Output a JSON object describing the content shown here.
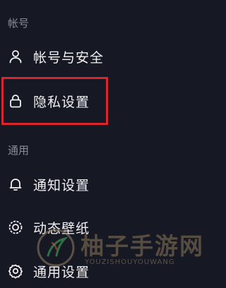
{
  "sections": [
    {
      "header": "帐号",
      "items": [
        {
          "label": "帐号与安全",
          "icon": "person-icon"
        },
        {
          "label": "隐私设置",
          "icon": "lock-icon"
        }
      ]
    },
    {
      "header": "通用",
      "items": [
        {
          "label": "通知设置",
          "icon": "bell-icon"
        },
        {
          "label": "动态壁纸",
          "icon": "wallpaper-icon"
        },
        {
          "label": "通用设置",
          "icon": "gear-icon"
        }
      ]
    }
  ],
  "watermark": {
    "text": "柚子手游网",
    "subtext": "YOUZISHOUYOUWANG"
  },
  "colors": {
    "background": "#161823",
    "highlight": "#d9262e",
    "section_header": "#8a8b93",
    "item_text": "#f1f1f3"
  }
}
